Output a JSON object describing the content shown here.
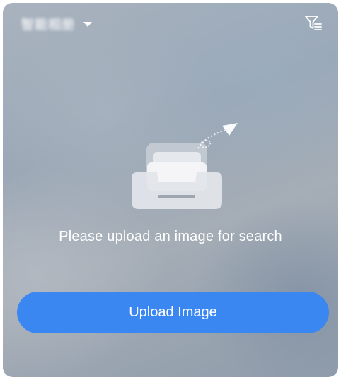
{
  "header": {
    "album_name": "智能相册",
    "album_dropdown_icon": "caret-down-icon",
    "filter_icon": "filter-list-icon"
  },
  "empty_state": {
    "illustration_icon": "upload-tray-icon",
    "message": "Please upload an image for search"
  },
  "actions": {
    "upload_label": "Upload Image"
  },
  "colors": {
    "button": "#3b87f2",
    "text": "#ffffff"
  }
}
